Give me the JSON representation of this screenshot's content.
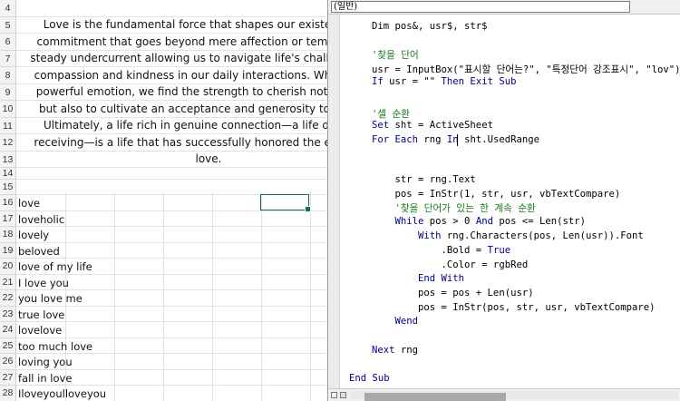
{
  "sheet": {
    "row_numbers": [
      "4",
      "5",
      "6",
      "7",
      "8",
      "9",
      "10",
      "11",
      "12",
      "13",
      "14",
      "15",
      "16",
      "17",
      "18",
      "19",
      "20",
      "21",
      "22",
      "23",
      "24",
      "25",
      "26",
      "27",
      "28"
    ],
    "paragraph_lines": [
      "Love is the fundamental force that shapes our existence, a c",
      "commitment that goes beyond mere affection or temporary pa",
      "steady undercurrent allowing us to navigate life's challenges, urg",
      "compassion and kindness in our daily interactions. When we tru",
      "powerful emotion, we find the strength to cherish not only thos",
      "but also to cultivate an acceptance and generosity toward the",
      "Ultimately, a life rich in genuine connection—a life defined b",
      "receiving—is a life that has successfully honored the essential h",
      "love."
    ],
    "cells": [
      "love",
      "loveholic",
      "lovely",
      "beloved",
      "love of my life",
      "I love you",
      "you love me",
      "true love",
      "lovelove",
      "too much love",
      "loving you",
      "fall in love",
      "Iloveyoulloveyou"
    ]
  },
  "vba": {
    "dropdown": "(일반)",
    "code_lines": [
      [
        {
          "t": "Dim pos&, usr$, str$",
          "k": "n"
        }
      ],
      [
        {
          "t": "",
          "k": "n"
        }
      ],
      [
        {
          "t": "'찾을 단어",
          "k": "c"
        }
      ],
      [
        {
          "t": "usr = InputBox(\"표시할 단어는?\", \"특정단어 강조표시\", \"lov\")",
          "k": "n"
        }
      ],
      [
        {
          "t": "If",
          "k": "k"
        },
        {
          "t": " usr = \"\" ",
          "k": "n"
        },
        {
          "t": "Then Exit Sub",
          "k": "k"
        }
      ],
      [
        {
          "t": "",
          "k": "n"
        }
      ],
      [
        {
          "t": "'셀 순환",
          "k": "c"
        }
      ],
      [
        {
          "t": "Set",
          "k": "k"
        },
        {
          "t": " sht = ActiveSheet",
          "k": "n"
        }
      ],
      [
        {
          "t": "For Each",
          "k": "k"
        },
        {
          "t": " rng ",
          "k": "n"
        },
        {
          "t": "In",
          "k": "k"
        },
        {
          "t": " sht.UsedRange",
          "k": "n"
        }
      ],
      [
        {
          "t": "",
          "k": "n"
        }
      ],
      [
        {
          "t": "    str = rng.Text",
          "k": "n"
        }
      ],
      [
        {
          "t": "    pos = InStr(1, str, usr, vbTextCompare)",
          "k": "n"
        }
      ],
      [
        {
          "t": "    '찾을 단어가 있는 한 계속 순환",
          "k": "c"
        }
      ],
      [
        {
          "t": "    ",
          "k": "n"
        },
        {
          "t": "While",
          "k": "k"
        },
        {
          "t": " pos > 0 ",
          "k": "n"
        },
        {
          "t": "And",
          "k": "k"
        },
        {
          "t": " pos <= Len(str)",
          "k": "n"
        }
      ],
      [
        {
          "t": "        ",
          "k": "n"
        },
        {
          "t": "With",
          "k": "k"
        },
        {
          "t": " rng.Characters(pos, Len(usr)).Font",
          "k": "n"
        }
      ],
      [
        {
          "t": "            .Bold = ",
          "k": "n"
        },
        {
          "t": "True",
          "k": "k"
        }
      ],
      [
        {
          "t": "            .Color = rgbRed",
          "k": "n"
        }
      ],
      [
        {
          "t": "        ",
          "k": "n"
        },
        {
          "t": "End With",
          "k": "k"
        }
      ],
      [
        {
          "t": "        pos = pos + Len(usr)",
          "k": "n"
        }
      ],
      [
        {
          "t": "        pos = InStr(pos, str, usr, vbTextCompare)",
          "k": "n"
        }
      ],
      [
        {
          "t": "    ",
          "k": "n"
        },
        {
          "t": "Wend",
          "k": "k"
        }
      ],
      [
        {
          "t": "",
          "k": "n"
        }
      ],
      [
        {
          "t": "Next",
          "k": "k"
        },
        {
          "t": " rng",
          "k": "n"
        }
      ],
      [
        {
          "t": "",
          "k": "n"
        }
      ],
      [
        {
          "t": "End Sub",
          "k": "k"
        }
      ]
    ]
  }
}
